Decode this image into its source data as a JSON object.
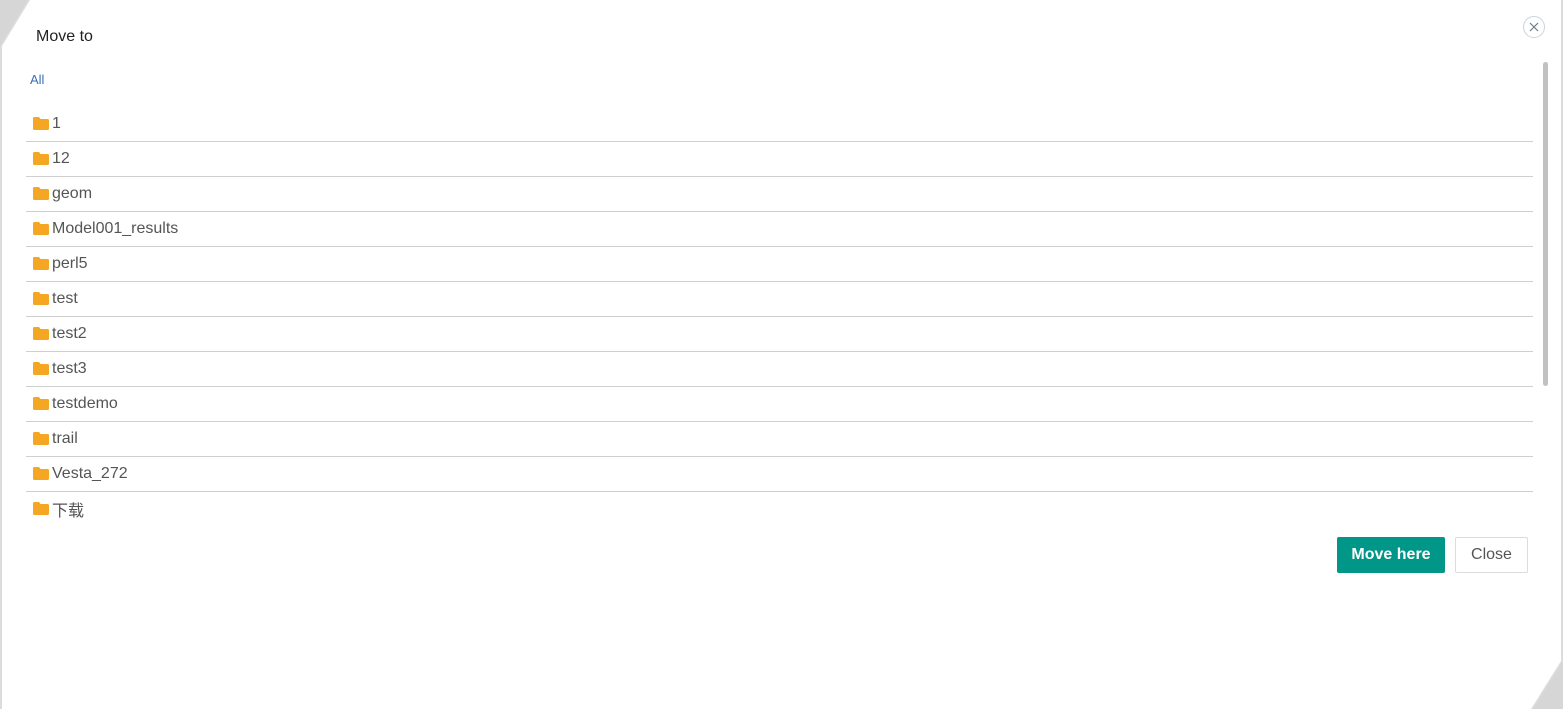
{
  "dialog": {
    "title": "Move to",
    "close_icon": "close-icon",
    "breadcrumb": "All"
  },
  "folders": [
    {
      "name": "1"
    },
    {
      "name": "12"
    },
    {
      "name": "geom"
    },
    {
      "name": "Model001_results"
    },
    {
      "name": "perl5"
    },
    {
      "name": "test"
    },
    {
      "name": "test2"
    },
    {
      "name": "test3"
    },
    {
      "name": "testdemo"
    },
    {
      "name": "trail"
    },
    {
      "name": "Vesta_272"
    },
    {
      "name": "下载"
    }
  ],
  "folder_icon": "folder-icon",
  "colors": {
    "folder": "#f5a623",
    "primary": "#009688",
    "link": "#3a6fb5"
  },
  "buttons": {
    "move_here": "Move here",
    "close": "Close"
  }
}
